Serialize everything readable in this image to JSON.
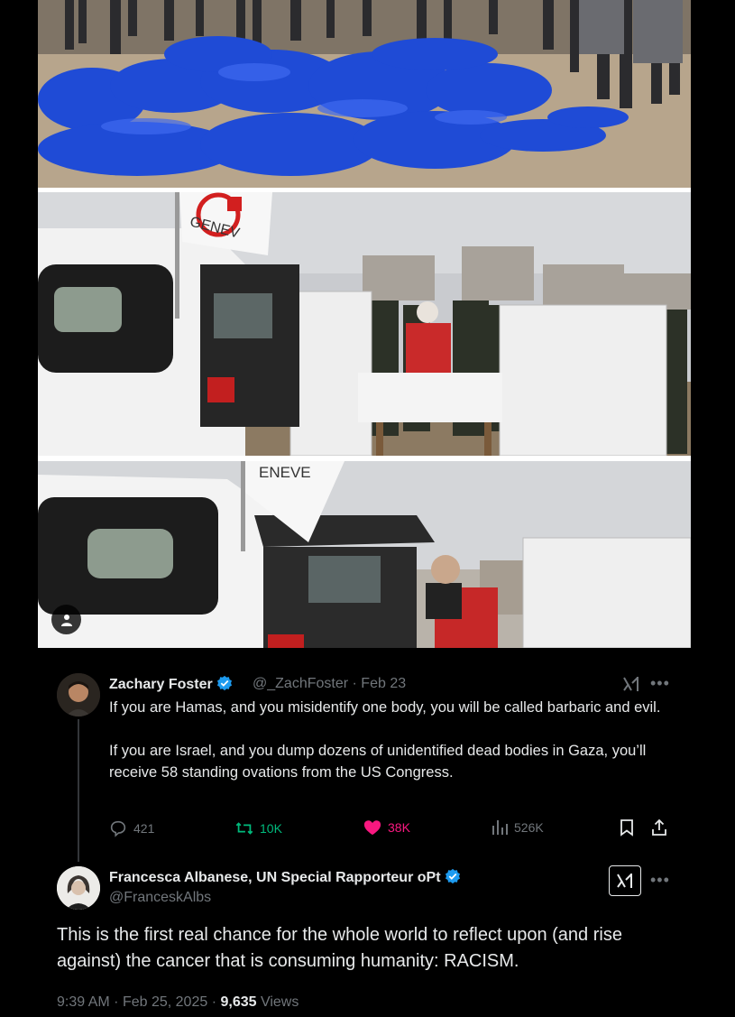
{
  "quoted_tweet": {
    "author_name": "Zachary Foster",
    "handle": "@_ZachFoster",
    "date": "Feb 23",
    "text_paragraphs": [
      "If you are Hamas, and you misidentify one body, you will be called barbaric and evil.",
      "If you are Israel, and you dump dozens of unidentified dead bodies in Gaza, you’ll receive 58 standing ovations from the US Congress."
    ],
    "stats": {
      "replies": "421",
      "reposts": "10K",
      "likes": "38K",
      "views": "526K"
    },
    "colors": {
      "repost": "#00ba7c",
      "like": "#f91880",
      "verified": "#1d9bf0"
    }
  },
  "main_tweet": {
    "author_name": "Francesca Albanese, UN Special Rapporteur oPt",
    "handle": "@FranceskAlbs",
    "text": "This is the first real chance for the whole world to reflect upon (and rise against) the cancer that is consuming humanity: RACISM.",
    "time": "9:39 AM",
    "date": "Feb 25, 2025",
    "views_count": "9,635",
    "views_label": "Views",
    "separator": "·"
  },
  "media": {
    "flag_text_1": "GENEV",
    "flag_text_2": "ENEVE"
  },
  "icons": {
    "verified": "verified-badge-icon",
    "grok": "grok-icon",
    "more": "more-icon",
    "reply": "reply-icon",
    "repost": "repost-icon",
    "like": "like-icon",
    "views": "views-icon",
    "bookmark": "bookmark-icon",
    "share": "share-icon",
    "person": "person-icon"
  }
}
